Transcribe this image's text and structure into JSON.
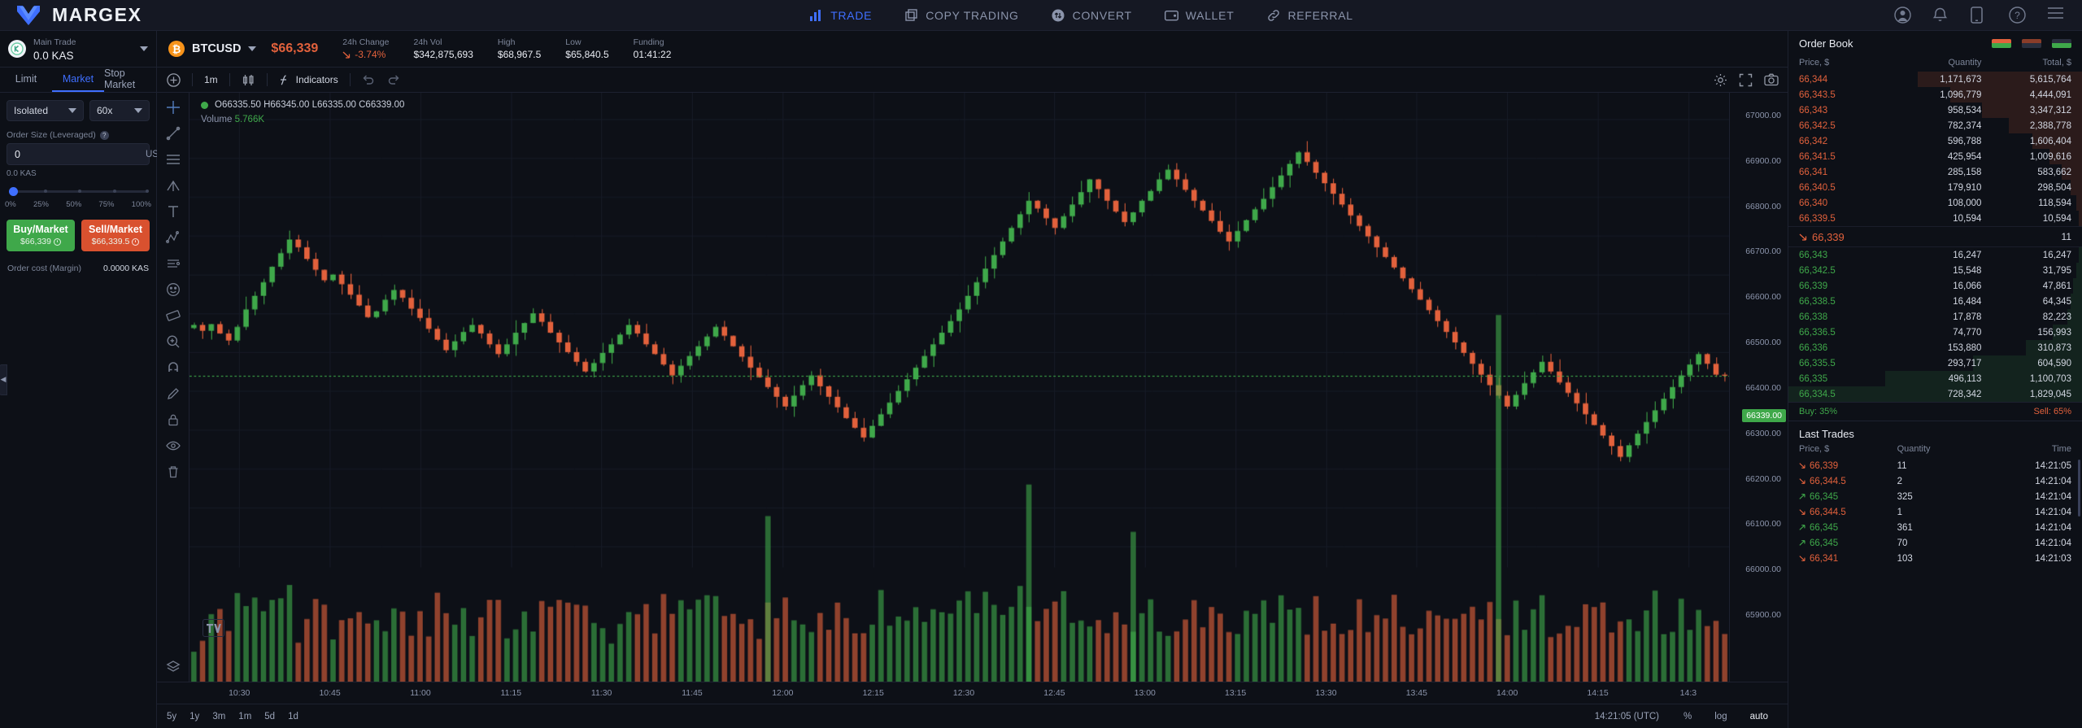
{
  "brand": {
    "name": "MARGEX"
  },
  "nav": {
    "items": [
      {
        "label": "TRADE",
        "icon": "bar-chart-icon",
        "active": true
      },
      {
        "label": "COPY TRADING",
        "icon": "copy-icon",
        "active": false
      },
      {
        "label": "CONVERT",
        "icon": "convert-icon",
        "active": false
      },
      {
        "label": "WALLET",
        "icon": "wallet-icon",
        "active": false
      },
      {
        "label": "REFERRAL",
        "icon": "link-icon",
        "active": false
      }
    ],
    "right_icons": [
      "user-icon",
      "bell-icon",
      "mobile-icon",
      "help-icon",
      "menu-icon"
    ]
  },
  "order_panel": {
    "account": {
      "label": "Main Trade",
      "value": "0.0 KAS",
      "coin": "KAS"
    },
    "tabs": [
      {
        "label": "Limit",
        "active": false
      },
      {
        "label": "Market",
        "active": true
      },
      {
        "label": "Stop Market",
        "active": false
      }
    ],
    "margin_mode": "Isolated",
    "leverage": "60x",
    "size_label": "Order Size (Leveraged)",
    "size_value": "0",
    "size_unit": "USD",
    "size_sub": "0.0 KAS",
    "slider_ticks": [
      "0%",
      "25%",
      "50%",
      "75%",
      "100%"
    ],
    "slider_percent": 0,
    "buy": {
      "label": "Buy/Market",
      "price": "$66,339"
    },
    "sell": {
      "label": "Sell/Market",
      "price": "$66,339.5"
    },
    "cost_label": "Order cost (Margin)",
    "cost_value": "0.0000 KAS"
  },
  "ticker": {
    "symbol": "BTCUSD",
    "price": "$66,339",
    "stats": [
      {
        "label": "24h Change",
        "value": "-3.74%",
        "down": true
      },
      {
        "label": "24h Vol",
        "value": "$342,875,693",
        "down": false
      },
      {
        "label": "High",
        "value": "$68,967.5",
        "down": false
      },
      {
        "label": "Low",
        "value": "$65,840.5",
        "down": false
      },
      {
        "label": "Funding",
        "value": "01:41:22",
        "down": false
      }
    ]
  },
  "chart_toolbar": {
    "timeframe": "1m",
    "indicators": "Indicators",
    "icons": [
      "crosshair-icon",
      "candlestick-icon",
      "function-icon",
      "undo-icon",
      "redo-icon",
      "settings-icon",
      "fullscreen-icon",
      "camera-icon"
    ]
  },
  "chart_legend": {
    "ohlc": "O66335.50 H66345.00 L66335.00 C66339.00",
    "volume_label": "Volume",
    "volume_value": "5.766K"
  },
  "chart_data": {
    "type": "line",
    "title": "BTCUSD 1m candlestick",
    "price_ticks": [
      67000.0,
      66900.0,
      66800.0,
      66700.0,
      66600.0,
      66500.0,
      66400.0,
      66300.0,
      66200.0,
      66100.0,
      66000.0,
      65900.0
    ],
    "current_price": "66339.00",
    "ylim": [
      65850,
      67050
    ],
    "time_ticks": [
      "10:30",
      "10:45",
      "11:00",
      "11:15",
      "11:30",
      "11:45",
      "12:00",
      "12:15",
      "12:30",
      "12:45",
      "13:00",
      "13:15",
      "13:30",
      "13:45",
      "14:00",
      "14:15",
      "14:3"
    ],
    "closes": [
      66470,
      66455,
      66472,
      66448,
      66430,
      66465,
      66510,
      66545,
      66580,
      66620,
      66655,
      66690,
      66670,
      66640,
      66612,
      66585,
      66600,
      66575,
      66548,
      66520,
      66490,
      66505,
      66535,
      66560,
      66540,
      66512,
      66488,
      66460,
      66432,
      66405,
      66428,
      66452,
      66470,
      66448,
      66420,
      66395,
      66420,
      66450,
      66475,
      66500,
      66478,
      66450,
      66425,
      66400,
      66375,
      66350,
      66372,
      66398,
      66420,
      66445,
      66470,
      66448,
      66420,
      66395,
      66368,
      66340,
      66365,
      66390,
      66415,
      66440,
      66465,
      66442,
      66415,
      66388,
      66360,
      66335,
      66310,
      66285,
      66260,
      66288,
      66315,
      66340,
      66312,
      66285,
      66258,
      66230,
      66205,
      66180,
      66210,
      66240,
      66270,
      66300,
      66330,
      66360,
      66390,
      66420,
      66450,
      66480,
      66510,
      66545,
      66580,
      66615,
      66650,
      66685,
      66720,
      66755,
      66790,
      66770,
      66745,
      66720,
      66750,
      66780,
      66812,
      66845,
      66820,
      66790,
      66762,
      66735,
      66760,
      66790,
      66815,
      66845,
      66870,
      66845,
      66818,
      66790,
      66765,
      66738,
      66710,
      66685,
      66712,
      66740,
      66768,
      66795,
      66825,
      66855,
      66885,
      66915,
      66890,
      66862,
      66835,
      66808,
      66780,
      66752,
      66725,
      66698,
      66670,
      66645,
      66618,
      66590,
      66562,
      66535,
      66508,
      66480,
      66452,
      66425,
      66398,
      66370,
      66342,
      66315,
      66288,
      66260,
      66290,
      66320,
      66348,
      66375,
      66350,
      66322,
      66295,
      66268,
      66240,
      66212,
      66185,
      66158,
      66130,
      66160,
      66190,
      66220,
      66250,
      66280,
      66310,
      66340,
      66368,
      66395,
      66370,
      66342,
      66339
    ],
    "volumes_peak": 5766
  },
  "chart_ranges": [
    {
      "label": "5y",
      "active": false
    },
    {
      "label": "1y",
      "active": false
    },
    {
      "label": "3m",
      "active": false
    },
    {
      "label": "1m",
      "active": false
    },
    {
      "label": "5d",
      "active": false
    },
    {
      "label": "1d",
      "active": false
    }
  ],
  "chart_footer": {
    "clock": "14:21:05 (UTC)",
    "scales": [
      {
        "label": "%",
        "active": false
      },
      {
        "label": "log",
        "active": false
      },
      {
        "label": "auto",
        "active": true
      }
    ]
  },
  "order_book": {
    "title": "Order Book",
    "columns": [
      "Price, $",
      "Quantity",
      "Total, $"
    ],
    "asks": [
      {
        "price": "66,344",
        "qty": "1,171,673",
        "total": "5,615,764",
        "depth": 56
      },
      {
        "price": "66,343.5",
        "qty": "1,096,779",
        "total": "4,444,091",
        "depth": 45
      },
      {
        "price": "66,343",
        "qty": "958,534",
        "total": "3,347,312",
        "depth": 34
      },
      {
        "price": "66,342.5",
        "qty": "782,374",
        "total": "2,388,778",
        "depth": 25
      },
      {
        "price": "66,342",
        "qty": "596,788",
        "total": "1,606,404",
        "depth": 17
      },
      {
        "price": "66,341.5",
        "qty": "425,954",
        "total": "1,009,616",
        "depth": 11
      },
      {
        "price": "66,341",
        "qty": "285,158",
        "total": "583,662",
        "depth": 7
      },
      {
        "price": "66,340.5",
        "qty": "179,910",
        "total": "298,504",
        "depth": 4
      },
      {
        "price": "66,340",
        "qty": "108,000",
        "total": "118,594",
        "depth": 2
      },
      {
        "price": "66,339.5",
        "qty": "10,594",
        "total": "10,594",
        "depth": 1
      }
    ],
    "mid": {
      "price": "66,339",
      "qty": "11"
    },
    "bids": [
      {
        "price": "66,343",
        "qty": "16,247",
        "total": "16,247",
        "depth": 1
      },
      {
        "price": "66,342.5",
        "qty": "15,548",
        "total": "31,795",
        "depth": 2
      },
      {
        "price": "66,339",
        "qty": "16,066",
        "total": "47,861",
        "depth": 3
      },
      {
        "price": "66,338.5",
        "qty": "16,484",
        "total": "64,345",
        "depth": 4
      },
      {
        "price": "66,338",
        "qty": "17,878",
        "total": "82,223",
        "depth": 5
      },
      {
        "price": "66,336.5",
        "qty": "74,770",
        "total": "156,993",
        "depth": 10
      },
      {
        "price": "66,336",
        "qty": "153,880",
        "total": "310,873",
        "depth": 19
      },
      {
        "price": "66,335.5",
        "qty": "293,717",
        "total": "604,590",
        "depth": 37
      },
      {
        "price": "66,335",
        "qty": "496,113",
        "total": "1,100,703",
        "depth": 67
      },
      {
        "price": "66,334.5",
        "qty": "728,342",
        "total": "1,829,045",
        "depth": 100
      }
    ],
    "buy_ratio": "Buy: 35%",
    "sell_ratio": "Sell: 65%"
  },
  "last_trades": {
    "title": "Last Trades",
    "columns": [
      "Price, $",
      "Quantity",
      "Time"
    ],
    "rows": [
      {
        "price": "66,339",
        "qty": "11",
        "time": "14:21:05",
        "dir": "dn"
      },
      {
        "price": "66,344.5",
        "qty": "2",
        "time": "14:21:04",
        "dir": "dn"
      },
      {
        "price": "66,345",
        "qty": "325",
        "time": "14:21:04",
        "dir": "up"
      },
      {
        "price": "66,344.5",
        "qty": "1",
        "time": "14:21:04",
        "dir": "dn"
      },
      {
        "price": "66,345",
        "qty": "361",
        "time": "14:21:04",
        "dir": "up"
      },
      {
        "price": "66,345",
        "qty": "70",
        "time": "14:21:04",
        "dir": "up"
      },
      {
        "price": "66,341",
        "qty": "103",
        "time": "14:21:03",
        "dir": "dn"
      }
    ]
  },
  "colors": {
    "accent": "#3f6fff",
    "up": "#3fa84a",
    "down": "#e2613c",
    "bg": "#0d1017",
    "panel": "#151823"
  }
}
